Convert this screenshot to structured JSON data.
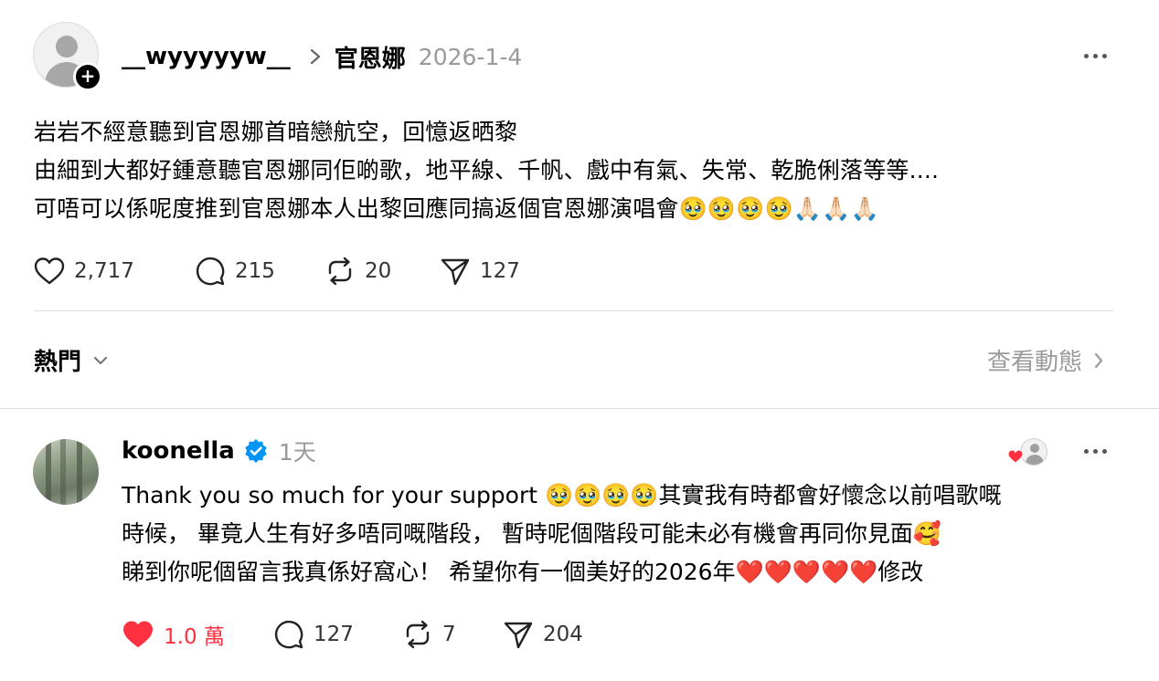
{
  "post": {
    "username": "__wyyyyyw__",
    "target": "官恩娜",
    "date": "2026-1-4",
    "lines": [
      "岩岩不經意聽到官恩娜首暗戀航空，回憶返晒黎",
      "由細到大都好鍾意聽官恩娜同佢啲歌，地平線、千帆、戲中有氣、失常、乾脆俐落等等....",
      "可唔可以係呢度推到官恩娜本人出黎回應同搞返個官恩娜演唱會🥹🥹🥹🥹🙏🏻🙏🏻🙏🏻"
    ],
    "likes": "2,717",
    "comments": "215",
    "reposts": "20",
    "shares": "127"
  },
  "filter": {
    "label": "熱門",
    "view_activity": "查看動態"
  },
  "reply": {
    "username": "koonella",
    "age": "1天",
    "lines": [
      "Thank you so much for your support 🥹🥹🥹🥹其實我有時都會好懷念以前唱歌嘅",
      "時候， 畢竟人生有好多唔同嘅階段， 暫時呢個階段可能未必有機會再同你見面🥰",
      "睇到你呢個留言我真係好窩心！ 希望你有一個美好的2026年❤️❤️❤️❤️❤️修改"
    ],
    "likes": "1.0 萬",
    "comments": "127",
    "reposts": "7",
    "shares": "204"
  },
  "colors": {
    "liked_red": "#ff3040",
    "verified_blue": "#0095f6",
    "muted_gray": "#9a9a9a"
  },
  "icons": {
    "like": "heart-icon",
    "comment": "comment-bubble-icon",
    "repost": "repost-icon",
    "share": "send-icon",
    "more": "more-dots-icon",
    "follow": "plus-icon"
  }
}
